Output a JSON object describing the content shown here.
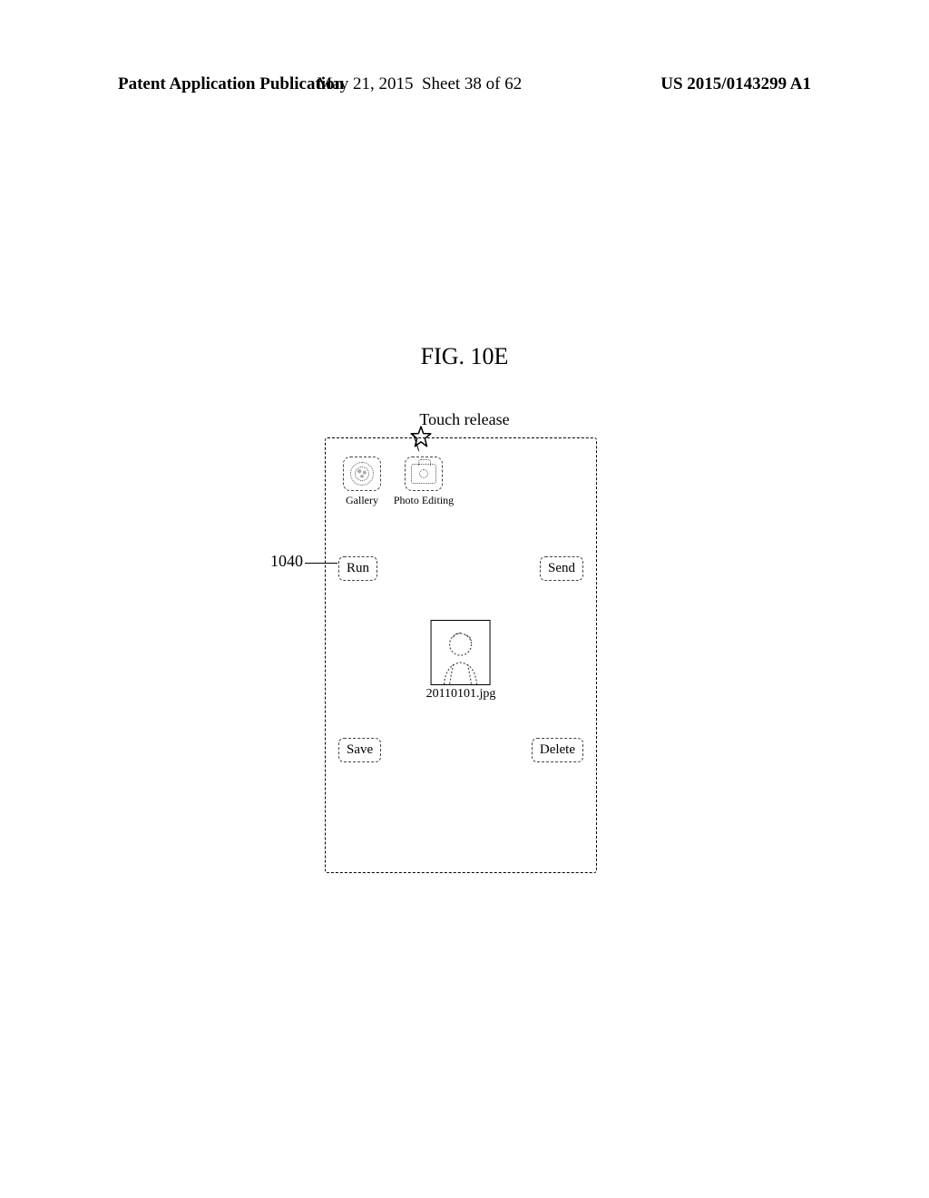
{
  "header": {
    "publication_type": "Patent Application Publication",
    "date": "May 21, 2015",
    "sheet": "Sheet 38 of 62",
    "pub_number": "US 2015/0143299 A1"
  },
  "figure": {
    "title": "FIG. 10E",
    "touch_release_label": "Touch release",
    "callout_number": "1040"
  },
  "device": {
    "apps": {
      "gallery": {
        "label": "Gallery"
      },
      "photo_editing": {
        "label": "Photo Editing"
      }
    },
    "buttons": {
      "run": "Run",
      "send": "Send",
      "save": "Save",
      "delete": "Delete"
    },
    "file": {
      "name": "20110101.jpg"
    }
  }
}
